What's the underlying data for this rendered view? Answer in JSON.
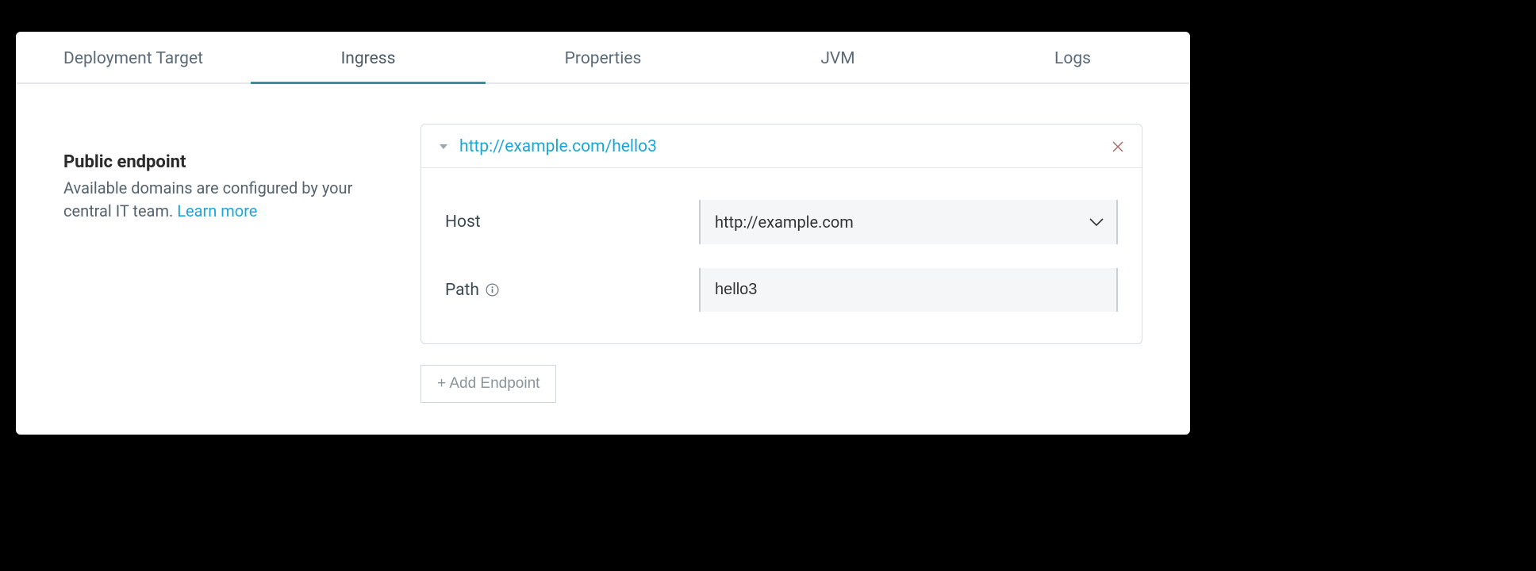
{
  "tabs": [
    {
      "label": "Deployment Target",
      "active": false
    },
    {
      "label": "Ingress",
      "active": true
    },
    {
      "label": "Properties",
      "active": false
    },
    {
      "label": "JVM",
      "active": false
    },
    {
      "label": "Logs",
      "active": false
    }
  ],
  "section": {
    "title": "Public endpoint",
    "description_prefix": "Available domains are configured by your central IT team. ",
    "learn_more": "Learn more"
  },
  "endpoint": {
    "url": "http://example.com/hello3",
    "fields": {
      "host": {
        "label": "Host",
        "value": "http://example.com"
      },
      "path": {
        "label": "Path",
        "value": "hello3"
      }
    }
  },
  "add_button": "+ Add Endpoint"
}
